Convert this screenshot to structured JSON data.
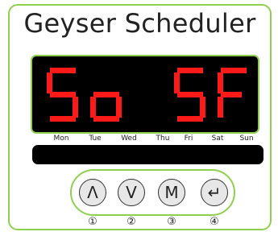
{
  "title": "Geyser Scheduler",
  "display": {
    "text": "So SF",
    "color": "#ff1a1a",
    "characters": [
      "S",
      "o",
      "",
      "S",
      "F"
    ]
  },
  "days": [
    "Mon",
    "Tue",
    "Wed",
    "Thu",
    "Fri",
    "Sat",
    "Sun"
  ],
  "buttons": [
    {
      "icon": "caret-up-icon",
      "glyph": "Λ",
      "number": "①"
    },
    {
      "icon": "caret-down-icon",
      "glyph": "V",
      "number": "②"
    },
    {
      "icon": "mode-icon",
      "glyph": "M",
      "number": "③"
    },
    {
      "icon": "enter-icon",
      "glyph": "↵",
      "number": "④"
    }
  ],
  "colors": {
    "accent": "#8fd14f",
    "segment": "#ff1a1a",
    "panel": "#000000"
  }
}
